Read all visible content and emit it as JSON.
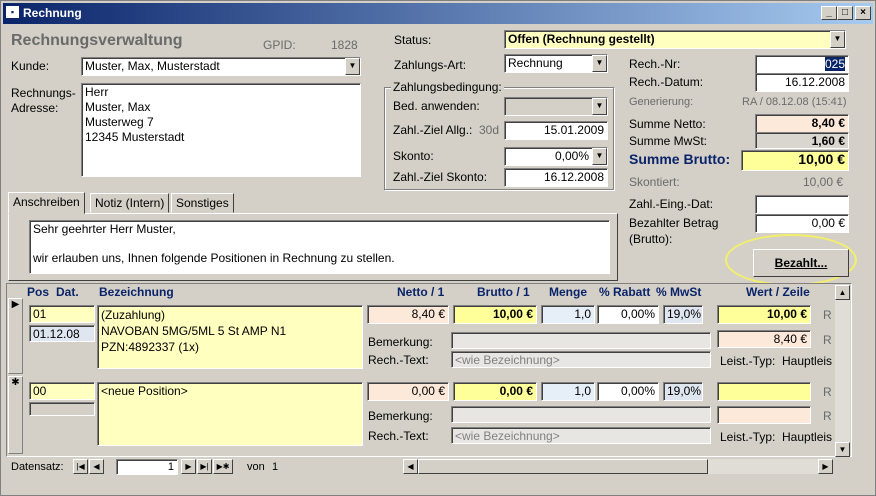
{
  "window": {
    "title": "Rechnung"
  },
  "header": {
    "heading": "Rechnungsverwaltung",
    "gpid_label": "GPID:",
    "gpid_value": "1828"
  },
  "customer": {
    "label": "Kunde:",
    "value": "Muster, Max, Musterstadt",
    "address_label_1": "Rechnungs-",
    "address_label_2": "Adresse:",
    "address": [
      "Herr",
      "Muster, Max",
      "Musterweg 7",
      "12345 Musterstadt"
    ]
  },
  "status": {
    "label": "Status:",
    "value": "Offen (Rechnung gestellt)"
  },
  "payment": {
    "type_label": "Zahlungs-Art:",
    "type_value": "Rechnung",
    "group_title": "Zahlungsbedingung:",
    "apply_label": "Bed. anwenden:",
    "apply_value": "",
    "due_label": "Zahl.-Ziel Allg.:",
    "due_days": "30d",
    "due_value": "15.01.2009",
    "discount_label": "Skonto:",
    "discount_value": "0,00%",
    "discount_due_label": "Zahl.-Ziel Skonto:",
    "discount_due_value": "16.12.2008"
  },
  "invoice": {
    "nr_label": "Rech.-Nr:",
    "nr_value": "025",
    "date_label": "Rech.-Datum:",
    "date_value": "16.12.2008",
    "gen_label": "Generierung:",
    "gen_value": "RA / 08.12.08 (15:41)"
  },
  "totals": {
    "net_label": "Summe Netto:",
    "net_value": "8,40 €",
    "vat_label": "Summe MwSt:",
    "vat_value": "1,60 €",
    "gross_label": "Summe Brutto:",
    "gross_value": "10,00 €",
    "discounted_label": "Skontiert:",
    "discounted_value": "10,00 €",
    "recv_date_label": "Zahl.-Eing.-Dat:",
    "recv_date_value": "",
    "paid_label_1": "Bezahlter Betrag",
    "paid_label_2": "(Brutto):",
    "paid_value": "0,00 €",
    "paid_button": "Bezahlt..."
  },
  "tabs": [
    {
      "label": "Anschreiben"
    },
    {
      "label": "Notiz (Intern)"
    },
    {
      "label": "Sonstiges"
    }
  ],
  "letter": {
    "line1": "Sehr geehrter Herr Muster,",
    "line2": "wir erlauben uns, Ihnen folgende Positionen in Rechnung zu stellen."
  },
  "columns": {
    "pos": "Pos",
    "dat": "Dat.",
    "bez": "Bezeichnung",
    "netto": "Netto / 1",
    "brutto": "Brutto / 1",
    "menge": "Menge",
    "rabatt": "% Rabatt",
    "mwst": "% MwSt",
    "wert": "Wert / Zeile"
  },
  "rows": [
    {
      "pos": "01",
      "dat": "01.12.08",
      "bez": [
        "(Zuzahlung)",
        "NAVOBAN 5MG/5ML   5 St AMP N1",
        "PZN:4892337 (1x)"
      ],
      "netto": "8,40 €",
      "brutto": "10,00 €",
      "menge": "1,0",
      "rabatt": "0,00%",
      "mwst": "19,0%",
      "wert_brutto": "10,00 €",
      "wert_netto": "8,40 €",
      "bem_label": "Bemerkung:",
      "rtext_label": "Rech.-Text:",
      "rtext": "<wie Bezeichnung>",
      "leist_label": "Leist.-Typ:",
      "leist_value": "Hauptleis",
      "cut": "R"
    },
    {
      "pos": "00",
      "dat": "",
      "bez": [
        "<neue Position>"
      ],
      "netto": "0,00 €",
      "brutto": "0,00 €",
      "menge": "1,0",
      "rabatt": "0,00%",
      "mwst": "19,0%",
      "wert_brutto": "",
      "wert_netto": "",
      "bem_label": "Bemerkung:",
      "rtext_label": "Rech.-Text:",
      "rtext": "<wie Bezeichnung>",
      "leist_label": "Leist.-Typ:",
      "leist_value": "Hauptleis",
      "cut": "R"
    }
  ],
  "nav": {
    "label": "Datensatz:",
    "current": "1",
    "of_label": "von",
    "total": "1"
  }
}
